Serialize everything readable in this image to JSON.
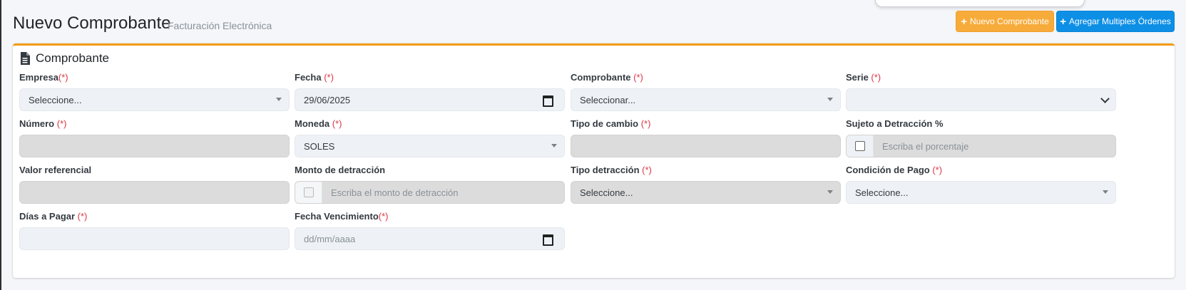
{
  "header": {
    "title": "Nuevo Comprobante",
    "subtitle": "Facturación Electrónica",
    "buttons": {
      "new_label": "Nuevo Comprobante",
      "multi_label": "Agregar Multiples Órdenes"
    },
    "colors": {
      "new_button": "#f7ab3a",
      "multi_button": "#0d8fe6"
    }
  },
  "card": {
    "title": "Comprobante",
    "icon": "file-text-icon",
    "accent_color": "#f39c12"
  },
  "form": {
    "required_mark": "(*)",
    "empresa": {
      "label": "Empresa",
      "value": "Seleccione..."
    },
    "fecha": {
      "label": "Fecha ",
      "value": "29/06/2025"
    },
    "comprobante": {
      "label": "Comprobante ",
      "value": "Seleccionar..."
    },
    "serie": {
      "label": "Serie ",
      "value": ""
    },
    "numero": {
      "label": "Número ",
      "value": ""
    },
    "moneda": {
      "label": "Moneda ",
      "value": "SOLES"
    },
    "tipo_cambio": {
      "label": "Tipo de cambio ",
      "value": ""
    },
    "detraccion_pct": {
      "label": "Sujeto a Detracción %",
      "placeholder": "Escriba el porcentaje",
      "checked": false
    },
    "valor_referencial": {
      "label": "Valor referencial",
      "value": ""
    },
    "monto_detraccion": {
      "label": "Monto de detracción",
      "placeholder": "Escriba el monto de detracción",
      "checked": false
    },
    "tipo_detraccion": {
      "label": "Tipo detracción ",
      "value": "Seleccione..."
    },
    "condicion_pago": {
      "label": "Condición de Pago ",
      "value": "Seleccione..."
    },
    "dias_pagar": {
      "label": "Días a Pagar ",
      "value": ""
    },
    "fecha_vencimiento": {
      "label": "Fecha Vencimiento",
      "placeholder": "dd/mm/aaaa"
    }
  }
}
